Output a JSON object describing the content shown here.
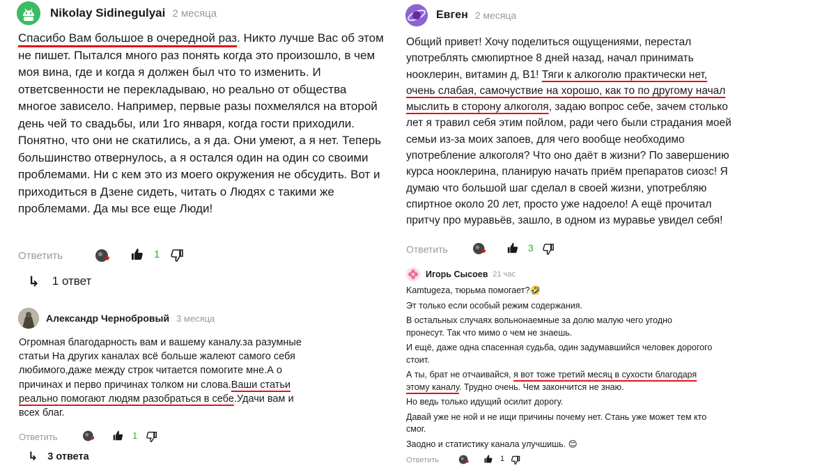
{
  "colors": {
    "link_underline": "#e2121b",
    "like_count": "#2bb32b",
    "muted": "#999999"
  },
  "comment1": {
    "author": "Nikolay Sidinegulyai",
    "ago": "2 месяца",
    "text": {
      "u1": "Спасибо Вам большое в очередной раз",
      "t1": ". Никто лучше Вас об этом не пишет. Пытался много раз понять когда это произошло, в чем моя вина, где и когда я должен был что то изменить. И ответсвенности не перекладываю, но реально от общества многое зависело. Например, первые разы похмелялся на второй день чей то свадьбы, или 1го января, когда гости приходили. Понятно, что они не скатились, а я да. Они умеют, а я нет. Теперь большинство отвернулось, а я остался один на один со своими проблемами. Ни с кем это из моего окружения не обсудить. Вот и приходиться в Дзене сидеть, читать о Людях с такими же проблемами. Да мы все еще Люди!"
    },
    "reply_label": "Ответить",
    "likes": "1",
    "replies": "1 ответ"
  },
  "comment2": {
    "author": "Александр Чернобровый",
    "ago": "3 месяца",
    "text": {
      "t1": "Огромная благодарность вам и вашему каналу.за разумные статьи На других каналах всё больше жалеют самого себя любимого,даже между строк читается помогите мне.А о причинах и перво причинах толком ни слова.",
      "u1": "Ваши статьи реально помогают людям разобраться в себе",
      "t2": ".Удачи вам и всех благ."
    },
    "reply_label": "Ответить",
    "likes": "1",
    "replies": "3 ответа"
  },
  "comment3": {
    "author": "Евген",
    "ago": "2 месяца",
    "text": {
      "t1": "Общий привет! Хочу поделиться ощущениями, перестал употреблять смюпиртное 8 дней назад, начал принимать нооклерин, витамин д, В1! ",
      "u1": "Тяги к алкоголю практически нет, очень слабая, самочуствие на хорошо, как то по другому начал мыслить в сторону алкоголя",
      "t2": ", задаю вопрос себе, зачем столько лет я травил себя этим пойлом, ради чего были страдания моей семьи из-за моих запоев, для чего вообще необходимо употребление алкоголя? Что оно даёт в жизни? По завершению курса нооклерина, планирую начать приём препаратов сиозс! Я думаю что большой шаг сделал в своей жизни, употребляю спиртное около 20 лет, просто уже надоело! А ещё прочитал притчу про муравьёв, зашло, в одном из муравье увидел себя!"
    },
    "reply_label": "Ответить",
    "likes": "3"
  },
  "comment4": {
    "author": "Игорь Сысоев",
    "ago": "21 час",
    "lines": {
      "p1": "Kamtugeza, тюрьма помогает?",
      "p2": "Эт только если особый режим содержания.",
      "p3": "В остальных случаях вольнонаемные за долю малую чего угодно пронесут. Так что мимо о чем не знаешь.",
      "p4": "И ещё, даже одна спасенная судьба, один задумавшийся человек дорогого стоит.",
      "p5a": "А ты, брат не отчаивайся, ",
      "p5u": "я вот тоже третий месяц в сухости благодаря этому каналу",
      "p5b": ". Трудно очень. Чем закончится не знаю.",
      "p6": "Но ведь только идущий осилит дорогу.",
      "p7": "Давай уже не ной и не ищи причины почему нет. Стань уже может тем кто смог.",
      "p8": "Заодно и статистику канала улучшишь."
    },
    "emoji_grin": "🤣",
    "emoji_smile": "😊",
    "reply_label": "Ответить",
    "likes": "1"
  }
}
